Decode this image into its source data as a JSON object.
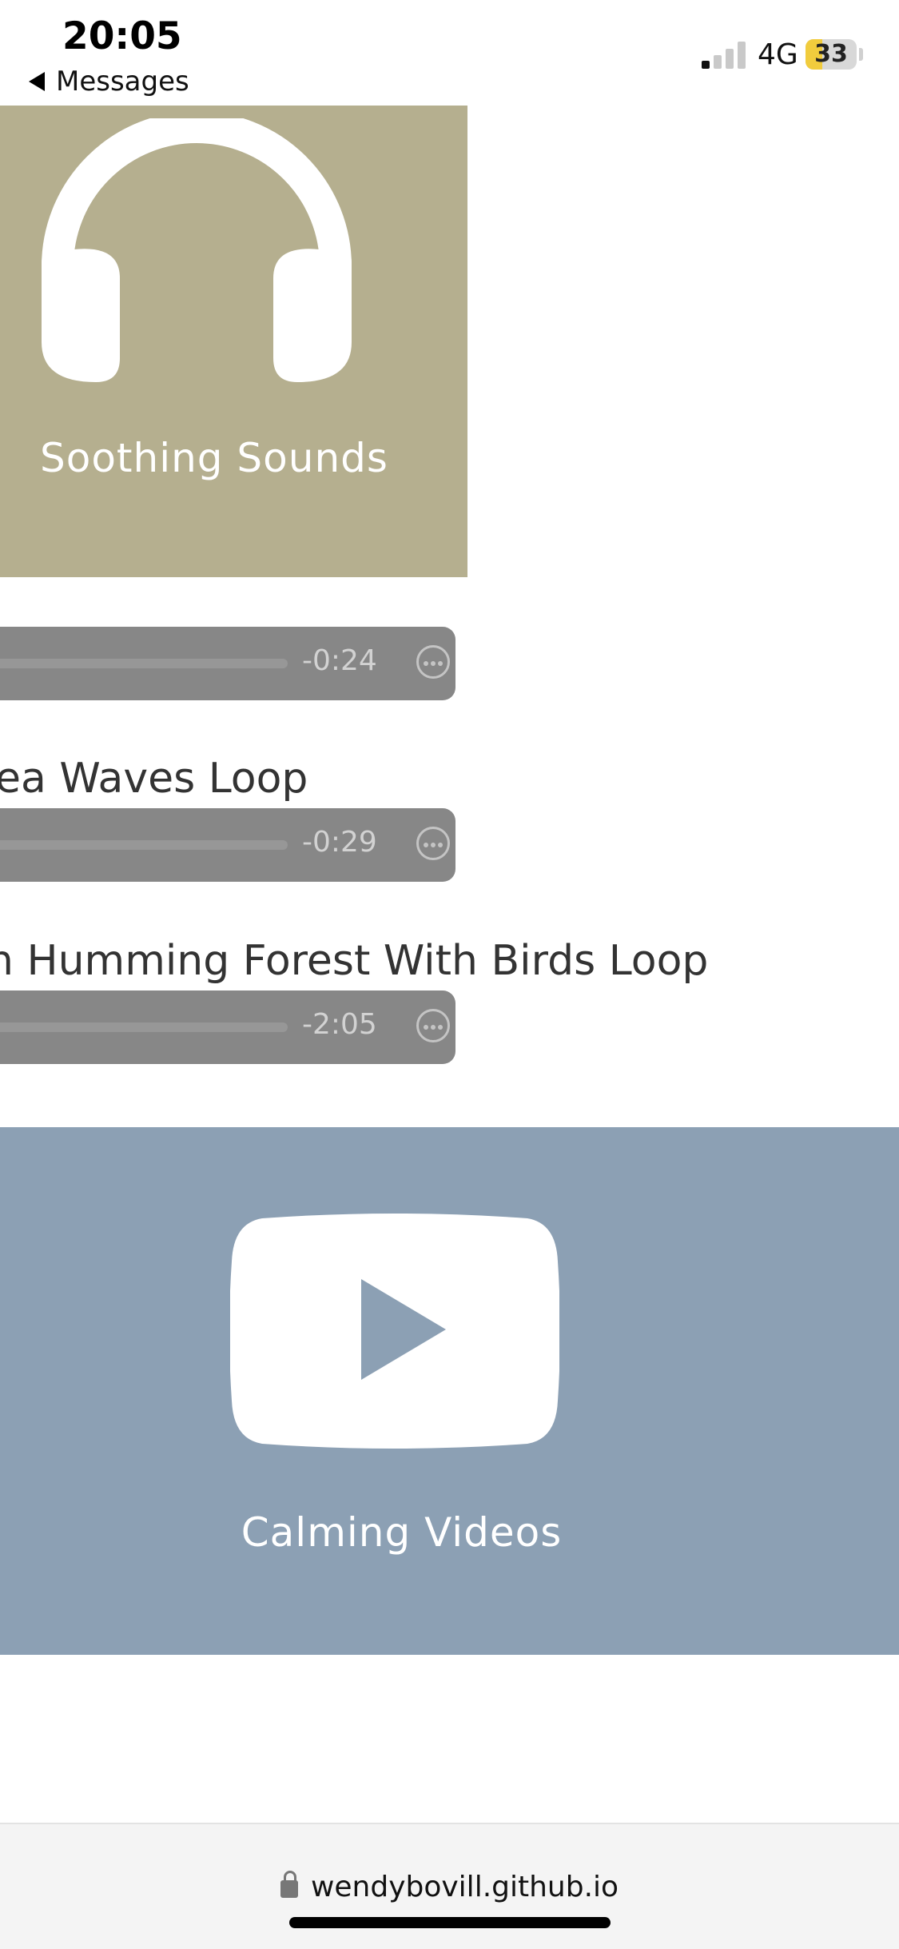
{
  "status_bar": {
    "time": "20:05",
    "back_label": "Messages",
    "network": "4G",
    "battery_level": "33",
    "battery_fraction": 0.33,
    "battery_color": "#f1cc3d"
  },
  "sounds_card": {
    "title": "Soothing Sounds",
    "icon": "headphones-icon",
    "background": "#b5af8f"
  },
  "tracks": [
    {
      "title": "",
      "remaining": "-0:24"
    },
    {
      "title": "ea Waves Loop",
      "remaining": "-0:29"
    },
    {
      "title": "n Humming Forest With Birds Loop",
      "remaining": "-2:05"
    }
  ],
  "videos_card": {
    "title": "Calming Videos",
    "icon": "play-video-icon",
    "background": "#8ca0b4"
  },
  "browser": {
    "url": "wendybovill.github.io"
  }
}
